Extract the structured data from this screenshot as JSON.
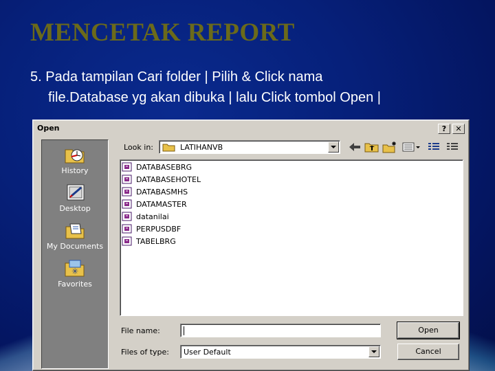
{
  "slide": {
    "title": "MENCETAK REPORT",
    "line1": "5. Pada tampilan Cari folder  | Pilih & Click nama",
    "line2": "file.Database yg akan dibuka | lalu Click tombol Open  |"
  },
  "dialog": {
    "title": "Open",
    "help_button": "?",
    "close_button": "✕",
    "places": [
      {
        "label": "History",
        "icon": "history-icon"
      },
      {
        "label": "Desktop",
        "icon": "desktop-icon"
      },
      {
        "label": "My Documents",
        "icon": "my-documents-icon"
      },
      {
        "label": "Favorites",
        "icon": "favorites-icon"
      }
    ],
    "look_in_label": "Look in:",
    "look_in_value": "LATIHANVB",
    "files": [
      "DATABASEBRG",
      "DATABASEHOTEL",
      "DATABASMHS",
      "DATAMASTER",
      "datanilai",
      "PERPUSDBF",
      "TABELBRG"
    ],
    "file_name_label": "File name:",
    "file_name_value": "",
    "files_of_type_label": "Files of type:",
    "files_of_type_value": "User Default",
    "open_button": "Open",
    "cancel_button": "Cancel"
  }
}
